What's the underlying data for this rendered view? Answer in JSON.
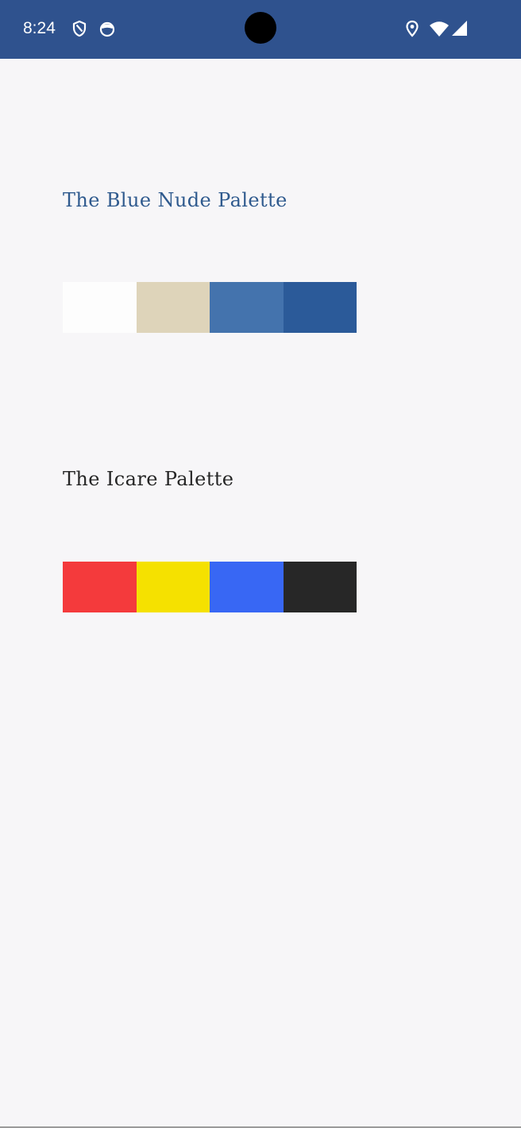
{
  "status_bar": {
    "time": "8:24",
    "background": "#2f528e",
    "left_icons": [
      "shield-icon",
      "cat-face-icon"
    ],
    "right_icons": [
      "location-pin-icon",
      "wifi-icon",
      "cell-signal-icon"
    ]
  },
  "palettes": [
    {
      "title": "The Blue Nude Palette",
      "title_color": "#2f5a8e",
      "swatches": [
        "#fdfdfd",
        "#ded4ba",
        "#4473ad",
        "#2b5a99"
      ]
    },
    {
      "title": "The Icare Palette",
      "title_color": "#262626",
      "swatches": [
        "#f43a3c",
        "#f5e100",
        "#3867f4",
        "#272727"
      ]
    }
  ]
}
